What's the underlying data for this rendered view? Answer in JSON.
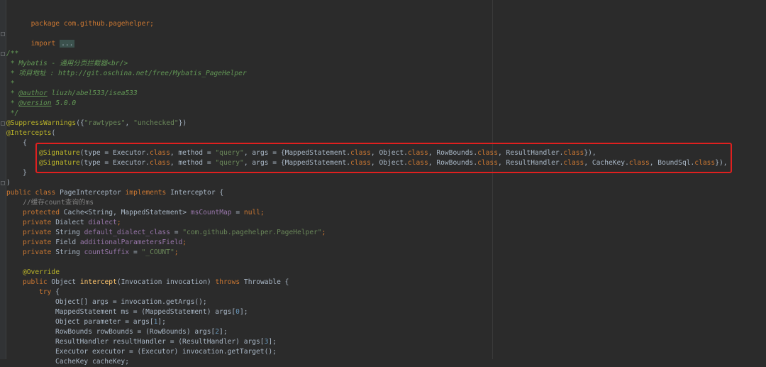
{
  "code": {
    "l01": "package com.github.pagehelper;",
    "l02_kw": "import",
    "l02_fold": "...",
    "l03": "/**",
    "l04": " * Mybatis - 通用分页拦截器<br/>",
    "l05": " * 项目地址 : http://git.oschina.net/free/Mybatis_PageHelper",
    "l06": " *",
    "l07a": " * ",
    "l07b": "@author",
    "l07c": " liuzh/abel533/isea533",
    "l08a": " * ",
    "l08b": "@version",
    "l08c": " 5.0.0",
    "l09": " */",
    "l10a": "@SuppressWarnings",
    "l10b": "({",
    "l10c": "\"rawtypes\"",
    "l10d": ", ",
    "l10e": "\"unchecked\"",
    "l10f": "})",
    "l11a": "@Intercepts",
    "l11b": "(",
    "l12": "    {",
    "sig_ann": "@Signature",
    "sig1_a": "(type = Executor.",
    "sig_class": "class",
    "sig_method": ", method = ",
    "sig_query": "\"query\"",
    "sig_args": ", args = {MappedStatement.",
    "sig_obj": ", Object.",
    "sig_rb": ", RowBounds.",
    "sig_rh": ", ResultHandler.",
    "sig1_end": "}),",
    "sig_ck": ", CacheKey.",
    "sig_bs": ", BoundSql.",
    "sig2_end": "}),",
    "l15": "    }",
    "l16": ")",
    "l17_public": "public",
    "l17_class": "class",
    "l17_name": " PageInterceptor ",
    "l17_impl": "implements",
    "l17_rest": " Interceptor {",
    "l18": "    //缓存count查询的ms",
    "l19_kw": "protected",
    "l19_type": " Cache<String, MappedStatement> ",
    "l19_fld": "msCountMap",
    "l19_eq": " = ",
    "l19_null": "null",
    "l19_end": ";",
    "l20_kw": "private",
    "l20_type": " Dialect ",
    "l20_fld": "dialect",
    "l21_kw": "private",
    "l21_type": " String ",
    "l21_fld": "default_dialect_class",
    "l21_eq": " = ",
    "l21_str": "\"com.github.pagehelper.PageHelper\"",
    "l22_kw": "private",
    "l22_type": " Field ",
    "l22_fld": "additionalParametersField",
    "l23_kw": "private",
    "l23_type": " String ",
    "l23_fld": "countSuffix",
    "l23_eq": " = ",
    "l23_str": "\"_COUNT\"",
    "semi": ";",
    "l25": "@Override",
    "l26_pub": "public",
    "l26_type": " Object ",
    "l26_fn": "intercept",
    "l26_args": "(Invocation invocation) ",
    "l26_throws": "throws",
    "l26_rest": " Throwable {",
    "l27_try": "try",
    "l27_rest": " {",
    "l28": "Object[] args = invocation.getArgs();",
    "l29a": "MappedStatement ms = (MappedStatement) args[",
    "l29n": "0",
    "l29b": "];",
    "l30a": "Object parameter = args[",
    "l30n": "1",
    "l30b": "];",
    "l31a": "RowBounds rowBounds = (RowBounds) args[",
    "l31n": "2",
    "l31b": "];",
    "l32a": "ResultHandler resultHandler = (ResultHandler) args[",
    "l32n": "3",
    "l32b": "];",
    "l33": "Executor executor = (Executor) invocation.getTarget();",
    "l34": "CacheKey cacheKey;"
  }
}
